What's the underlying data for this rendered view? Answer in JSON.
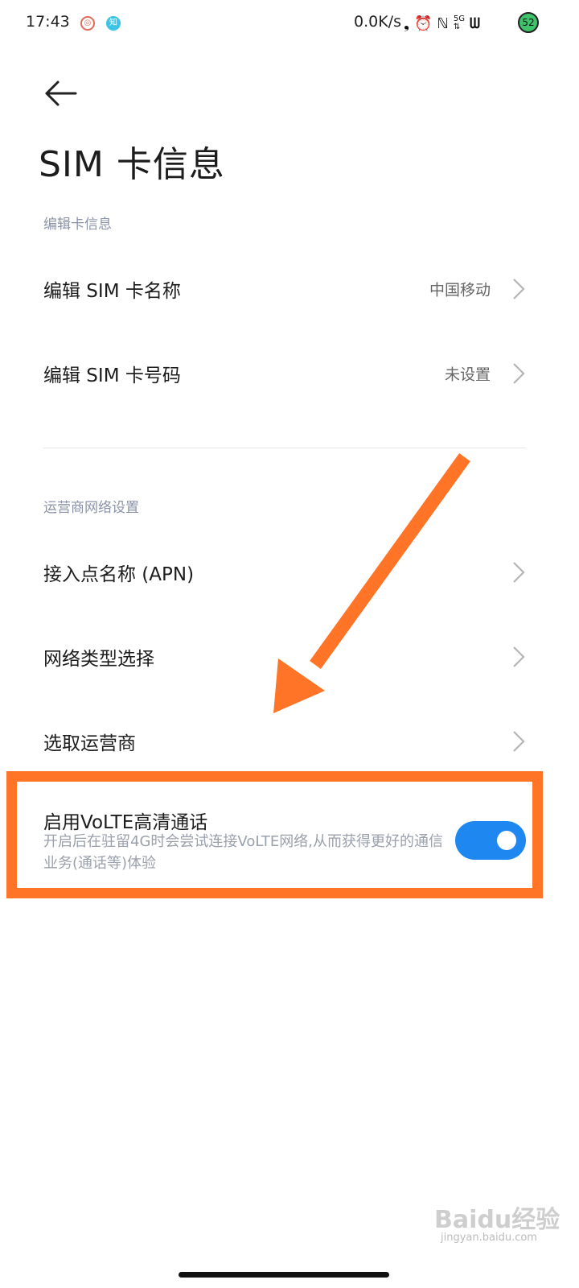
{
  "status_bar": {
    "time": "17:43",
    "app_icons": [
      "netease-music-icon",
      "zhihu-icon"
    ],
    "netspeed": "0.0K/s",
    "system_icons": [
      "hd-voice-icon",
      "alarm-icon",
      "nfc-icon",
      "5g-signal-icon",
      "wifi-icon"
    ],
    "battery_level": "52"
  },
  "page": {
    "title": "SIM 卡信息"
  },
  "sections": {
    "edit_card": {
      "header": "编辑卡信息",
      "items": [
        {
          "label": "编辑 SIM 卡名称",
          "value": "中国移动"
        },
        {
          "label": "编辑 SIM 卡号码",
          "value": "未设置"
        }
      ]
    },
    "carrier_network": {
      "header": "运营商网络设置",
      "items": [
        {
          "label": "接入点名称 (APN)"
        },
        {
          "label": "网络类型选择"
        },
        {
          "label": "选取运营商"
        }
      ]
    }
  },
  "volte": {
    "title": "启用VoLTE高清通话",
    "description": "开启后在驻留4G时会尝试连接VoLTE网络,从而获得更好的通信业务(通话等)体验",
    "enabled": true
  },
  "annotation": {
    "highlight_color": "#ff7426",
    "arrow_color": "#ff7426"
  },
  "colors": {
    "toggle_on": "#1e88f0",
    "section_header": "#8a93a8"
  },
  "watermark": {
    "text": "Baidu经验",
    "sub": "jingyan.baidu.com"
  }
}
